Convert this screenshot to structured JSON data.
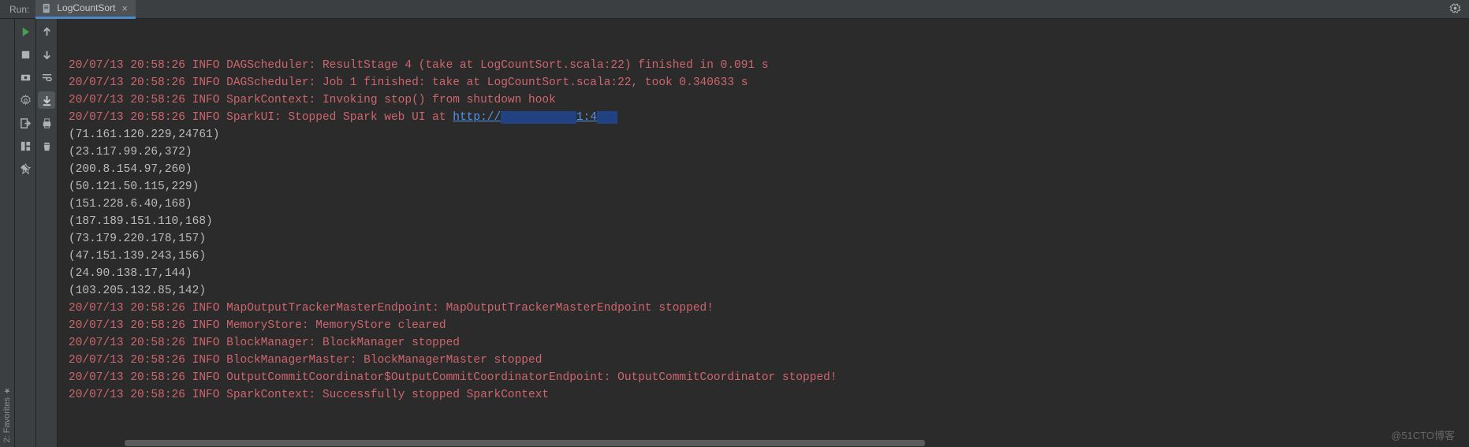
{
  "toolbar": {
    "run_label": "Run:",
    "tab_name": "LogCountSort"
  },
  "watermark": "@51CTO博客",
  "console": {
    "lines": [
      {
        "cls": "log-info",
        "text": "20/07/13 20:58:26 INFO DAGScheduler: ResultStage 4 (take at LogCountSort.scala:22) finished in 0.091 s"
      },
      {
        "cls": "log-info",
        "text": "20/07/13 20:58:26 INFO DAGScheduler: Job 1 finished: take at LogCountSort.scala:22, took 0.340633 s"
      },
      {
        "cls": "log-info",
        "text": "20/07/13 20:58:26 INFO SparkContext: Invoking stop() from shutdown hook"
      },
      {
        "cls": "log-info",
        "text": "20/07/13 20:58:26 INFO SparkUI: Stopped Spark web UI at ",
        "link": "http://",
        "masked1": "xxxxxxxxxxx",
        "link2": "1:4",
        "masked2": "xxx"
      },
      {
        "cls": "log-plain",
        "text": "(71.161.120.229,24761)"
      },
      {
        "cls": "log-plain",
        "text": "(23.117.99.26,372)"
      },
      {
        "cls": "log-plain",
        "text": "(200.8.154.97,260)"
      },
      {
        "cls": "log-plain",
        "text": "(50.121.50.115,229)"
      },
      {
        "cls": "log-plain",
        "text": "(151.228.6.40,168)"
      },
      {
        "cls": "log-plain",
        "text": "(187.189.151.110,168)"
      },
      {
        "cls": "log-plain",
        "text": "(73.179.220.178,157)"
      },
      {
        "cls": "log-plain",
        "text": "(47.151.139.243,156)"
      },
      {
        "cls": "log-plain",
        "text": "(24.90.138.17,144)"
      },
      {
        "cls": "log-plain",
        "text": "(103.205.132.85,142)"
      },
      {
        "cls": "log-info",
        "text": "20/07/13 20:58:26 INFO MapOutputTrackerMasterEndpoint: MapOutputTrackerMasterEndpoint stopped!"
      },
      {
        "cls": "log-info",
        "text": "20/07/13 20:58:26 INFO MemoryStore: MemoryStore cleared"
      },
      {
        "cls": "log-info",
        "text": "20/07/13 20:58:26 INFO BlockManager: BlockManager stopped"
      },
      {
        "cls": "log-info",
        "text": "20/07/13 20:58:26 INFO BlockManagerMaster: BlockManagerMaster stopped"
      },
      {
        "cls": "log-info",
        "text": "20/07/13 20:58:26 INFO OutputCommitCoordinator$OutputCommitCoordinatorEndpoint: OutputCommitCoordinator stopped!"
      },
      {
        "cls": "log-info",
        "text": "20/07/13 20:58:26 INFO SparkContext: Successfully stopped SparkContext"
      }
    ]
  }
}
